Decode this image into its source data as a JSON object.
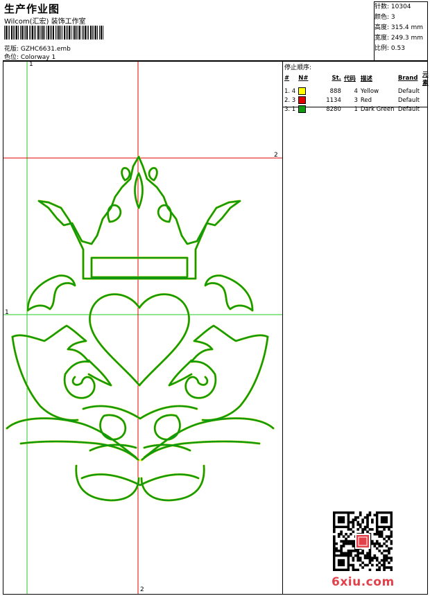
{
  "header": {
    "title": "生产作业图",
    "subtitle": "Wilcom(汇宏) 装饰工作室",
    "design_label": "花版: GZHC6631.emb",
    "colorway_label": "色位: Colorway 1"
  },
  "stats": {
    "stitches": "针数: 10304",
    "colors": "颜色: 3",
    "height": "高度: 315.4 mm",
    "width": "宽度: 249.3 mm",
    "scale": "比例: 0.53"
  },
  "stop_sequence": {
    "title": "停止顺序:",
    "headers": [
      "#",
      "N#",
      "St.",
      "代码",
      "描述",
      "Brand",
      "元素"
    ],
    "rows": [
      {
        "seq": "1. 4",
        "color": "#ffff00",
        "st": "888",
        "code": "4",
        "desc": "Yellow",
        "brand": "Default"
      },
      {
        "seq": "2. 3",
        "color": "#e00000",
        "st": "1134",
        "code": "3",
        "desc": "Red",
        "brand": "Default"
      },
      {
        "seq": "3. 1",
        "color": "#119911",
        "st": "8280",
        "code": "1",
        "desc": "Dark Green",
        "brand": "Default"
      }
    ]
  },
  "axes": {
    "label_1_top": "1",
    "label_1_left": "1",
    "label_2_right": "2",
    "label_2_bottom": "2"
  },
  "watermark": "6xiu.com",
  "colors": {
    "outline_green": "#119911",
    "outline_yellow": "#e6e600",
    "guide_red": "#e00000",
    "guide_green": "#22cc22"
  }
}
